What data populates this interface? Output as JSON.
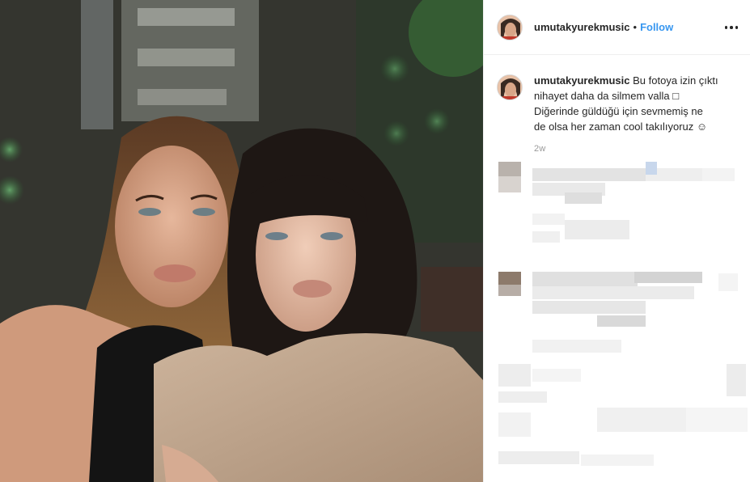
{
  "post": {
    "username": "umutakyurekmusic",
    "separator": "•",
    "follow_label": "Follow",
    "more_icon": "more-horizontal-icon",
    "caption": {
      "username": "umutakyurekmusic",
      "line1": "Bu fotoya izin çıktı",
      "line2": "nihayet daha da silmem valla □",
      "line3": "Diğerinde güldüğü için sevmemiş ne",
      "line4": "de olsa her zaman cool takılıyoruz ☺"
    },
    "timestamp": "2w"
  },
  "colors": {
    "link_blue": "#3897f0",
    "text": "#262626",
    "muted": "#999999"
  }
}
